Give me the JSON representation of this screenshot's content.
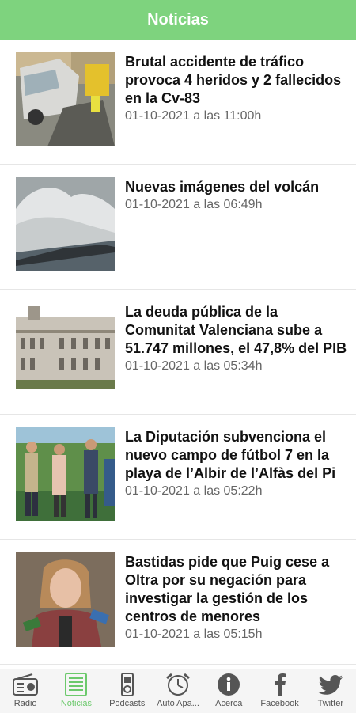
{
  "header": {
    "title": "Noticias",
    "color": "#7ed37e"
  },
  "news": [
    {
      "headline": "Brutal accidente de tráfico provoca 4 heridos y 2 fallecidos en la Cv-83",
      "date": "01-10-2021 a las 11:00h"
    },
    {
      "headline": "Nuevas imágenes del volcán",
      "date": "01-10-2021 a las 06:49h"
    },
    {
      "headline": "La deuda pública de la Comunitat Valenciana sube a 51.747 millones, el 47,8% del PIB",
      "date": "01-10-2021 a las 05:34h"
    },
    {
      "headline": "La Diputación subvenciona el nuevo campo de fútbol 7 en la playa de l’Albir de l’Alfàs del Pi",
      "date": "01-10-2021 a las 05:22h"
    },
    {
      "headline": "Bastidas pide que Puig cese a Oltra por su negación para investigar la gestión de los centros de menores",
      "date": "01-10-2021 a las 05:15h"
    }
  ],
  "tabs": [
    {
      "label": "Radio",
      "icon": "radio-icon"
    },
    {
      "label": "Noticias",
      "icon": "news-icon",
      "active": true
    },
    {
      "label": "Podcasts",
      "icon": "podcast-icon"
    },
    {
      "label": "Auto Apa...",
      "icon": "alarm-clock-icon"
    },
    {
      "label": "Acerca",
      "icon": "info-icon"
    },
    {
      "label": "Facebook",
      "icon": "facebook-icon"
    },
    {
      "label": "Twitter",
      "icon": "twitter-icon"
    }
  ]
}
